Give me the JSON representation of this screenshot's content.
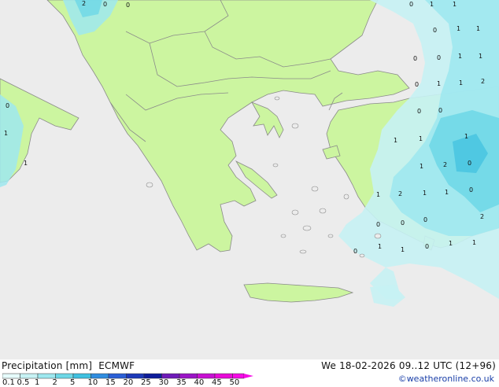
{
  "title": "Precipitation [mm]",
  "model": "ECMWF",
  "datetime": "We 18-02-2026 09..12 UTC (12+96)",
  "credit": "©weatheronline.co.uk",
  "legend": {
    "ticks": [
      "0.1",
      "0.5",
      "1",
      "2",
      "5",
      "10",
      "15",
      "20",
      "25",
      "30",
      "35",
      "40",
      "45",
      "50"
    ],
    "colors": [
      "#e6fbfb",
      "#c7f2f4",
      "#9ee8ef",
      "#6dd7e6",
      "#3fc0e0",
      "#2f8de0",
      "#2b5fd6",
      "#1c39b8",
      "#0d1c9a",
      "#6e1ab8",
      "#9b14c6",
      "#c70fd2",
      "#e80ad8",
      "#f50ae6"
    ]
  },
  "map_numbers": [
    "2",
    "0",
    "0",
    "0",
    "1",
    "1",
    "0",
    "1",
    "1",
    "0",
    "0",
    "1",
    "1",
    "0",
    "1",
    "1",
    "2",
    "0",
    "0",
    "0",
    "1",
    "1",
    "1",
    "1",
    "1",
    "2",
    "1",
    "0",
    "2",
    "1",
    "1",
    "1",
    "0",
    "2",
    "0",
    "0",
    "0",
    "1",
    "1",
    "0",
    "0",
    "1",
    "1"
  ],
  "colors": {
    "sea": "#ececec",
    "land": "#ccf5a0",
    "border": "#8a8a8a"
  }
}
